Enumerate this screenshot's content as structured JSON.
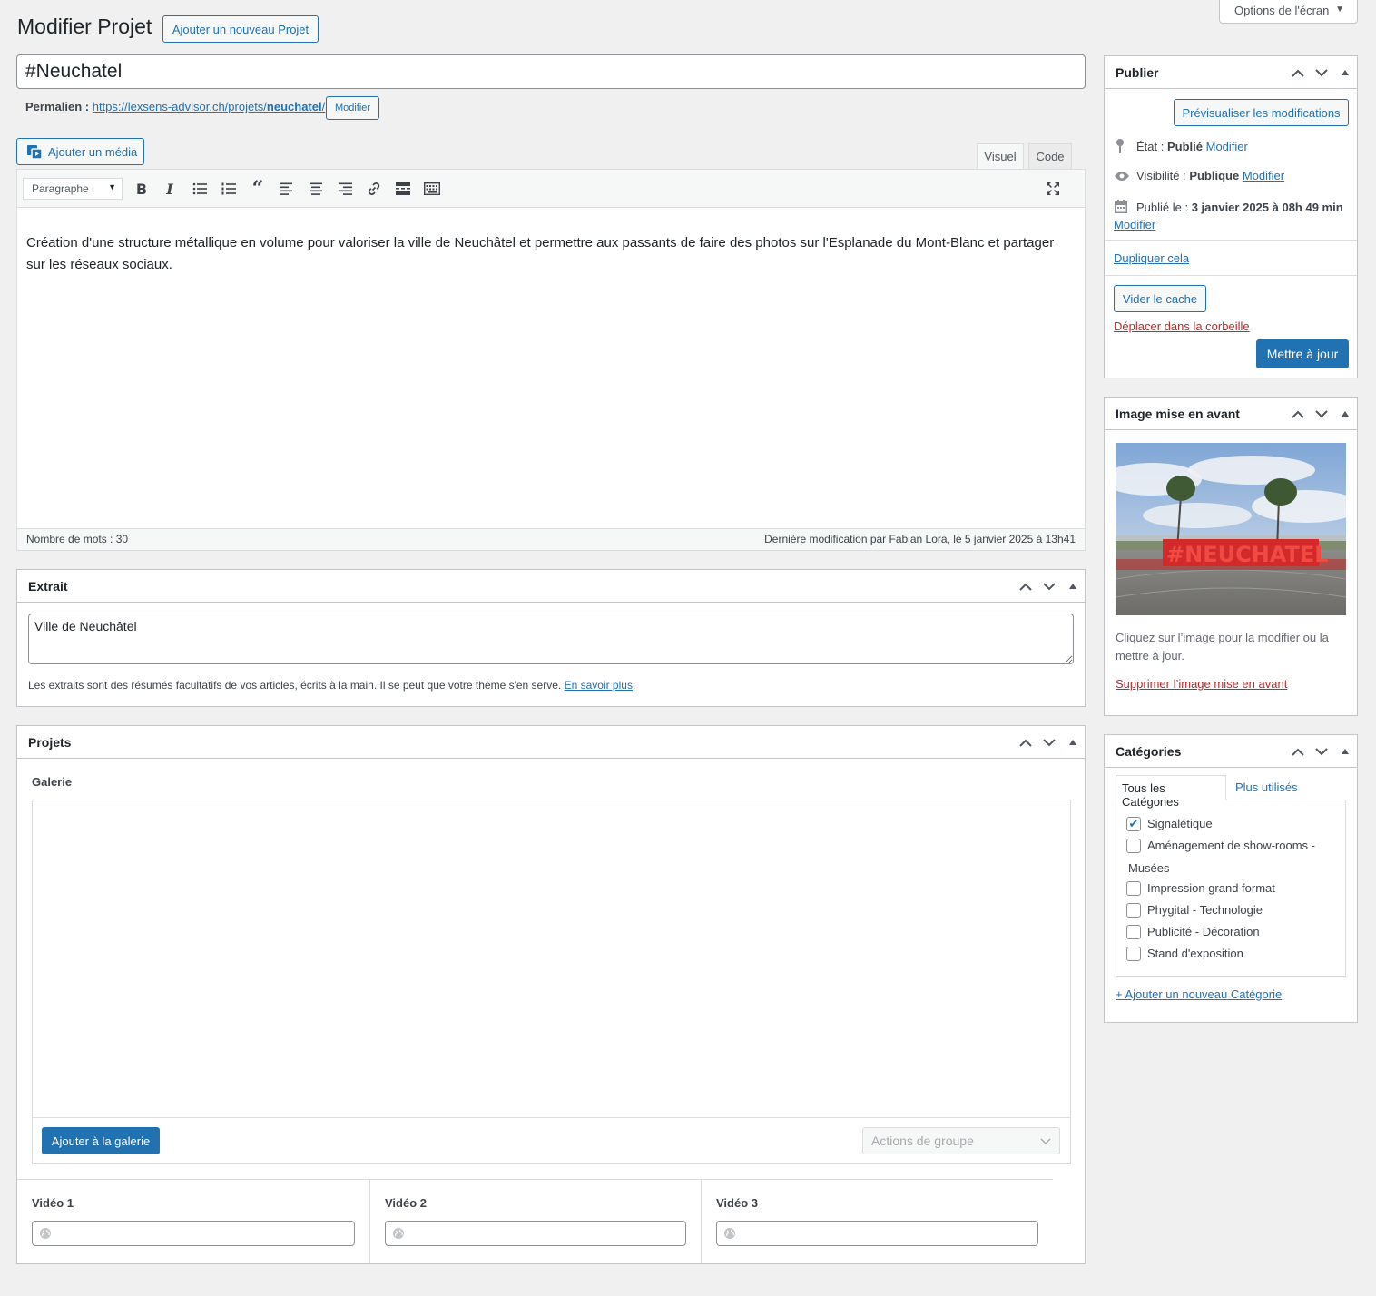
{
  "screen_options": {
    "label": "Options de l'écran"
  },
  "header": {
    "title": "Modifier Projet",
    "add_new_label": "Ajouter un nouveau Projet"
  },
  "post": {
    "title": "#Neuchatel",
    "permalink_label": "Permalien :",
    "permalink_url_prefix": "https://lexsens-advisor.ch/projets/",
    "permalink_slug": "neuchatel",
    "permalink_url_suffix": "/",
    "permalink_edit_label": "Modifier"
  },
  "editor": {
    "add_media_label": "Ajouter un média",
    "tab_visual": "Visuel",
    "tab_code": "Code",
    "format_select": "Paragraphe",
    "content": "Création d'une structure métallique en volume pour valoriser la ville de Neuchâtel et permettre aux passants de faire des photos sur l'Esplanade du Mont-Blanc et partager sur les réseaux sociaux.",
    "word_count": "Nombre de mots : 30",
    "last_modified": "Dernière modification par Fabian Lora, le 5 janvier 2025 à 13h41"
  },
  "excerpt": {
    "title": "Extrait",
    "value": "Ville de Neuchâtel",
    "help": "Les extraits sont des résumés facultatifs de vos articles, écrits à la main. Il se peut que votre thème s'en serve.",
    "learn_more": "En savoir plus",
    "period": "."
  },
  "projets": {
    "title": "Projets",
    "gallery_label": "Galerie",
    "add_gallery_label": "Ajouter à la galerie",
    "bulk_actions_placeholder": "Actions de groupe",
    "video1_label": "Vidéo 1",
    "video2_label": "Vidéo 2",
    "video3_label": "Vidéo 3"
  },
  "publish": {
    "title": "Publier",
    "preview_label": "Prévisualiser les modifications",
    "status_label": "État :",
    "status_value": "Publié",
    "visibility_label": "Visibilité :",
    "visibility_value": "Publique",
    "published_label": "Publié le :",
    "published_value": "3 janvier 2025 à 08h 49 min",
    "edit_label": "Modifier",
    "duplicate_label": "Dupliquer cela",
    "clear_cache_label": "Vider le cache",
    "trash_label": "Déplacer dans la corbeille",
    "update_label": "Mettre à jour"
  },
  "featured_image": {
    "title": "Image mise en avant",
    "help": "Cliquez sur l’image pour la modifier ou la mettre à jour.",
    "remove_label": "Supprimer l’image mise en avant",
    "image_lettering": "#NEUCHATEL"
  },
  "categories": {
    "title": "Catégories",
    "tab_all": "Tous les Catégories",
    "tab_popular": "Plus utilisés",
    "items": [
      {
        "label": "Signalétique",
        "checked": true
      },
      {
        "label": "Aménagement de show-rooms -",
        "label2": "Musées",
        "checked": false
      },
      {
        "label": "Impression grand format",
        "checked": false
      },
      {
        "label": "Phygital - Technologie",
        "checked": false
      },
      {
        "label": "Publicité - Décoration",
        "checked": false
      },
      {
        "label": "Stand d'exposition",
        "checked": false
      }
    ],
    "add_new_label": "+ Ajouter un nouveau Catégorie"
  },
  "colors": {
    "accent": "#2271b1",
    "danger": "#b32d2e",
    "background": "#f0f0f1"
  }
}
